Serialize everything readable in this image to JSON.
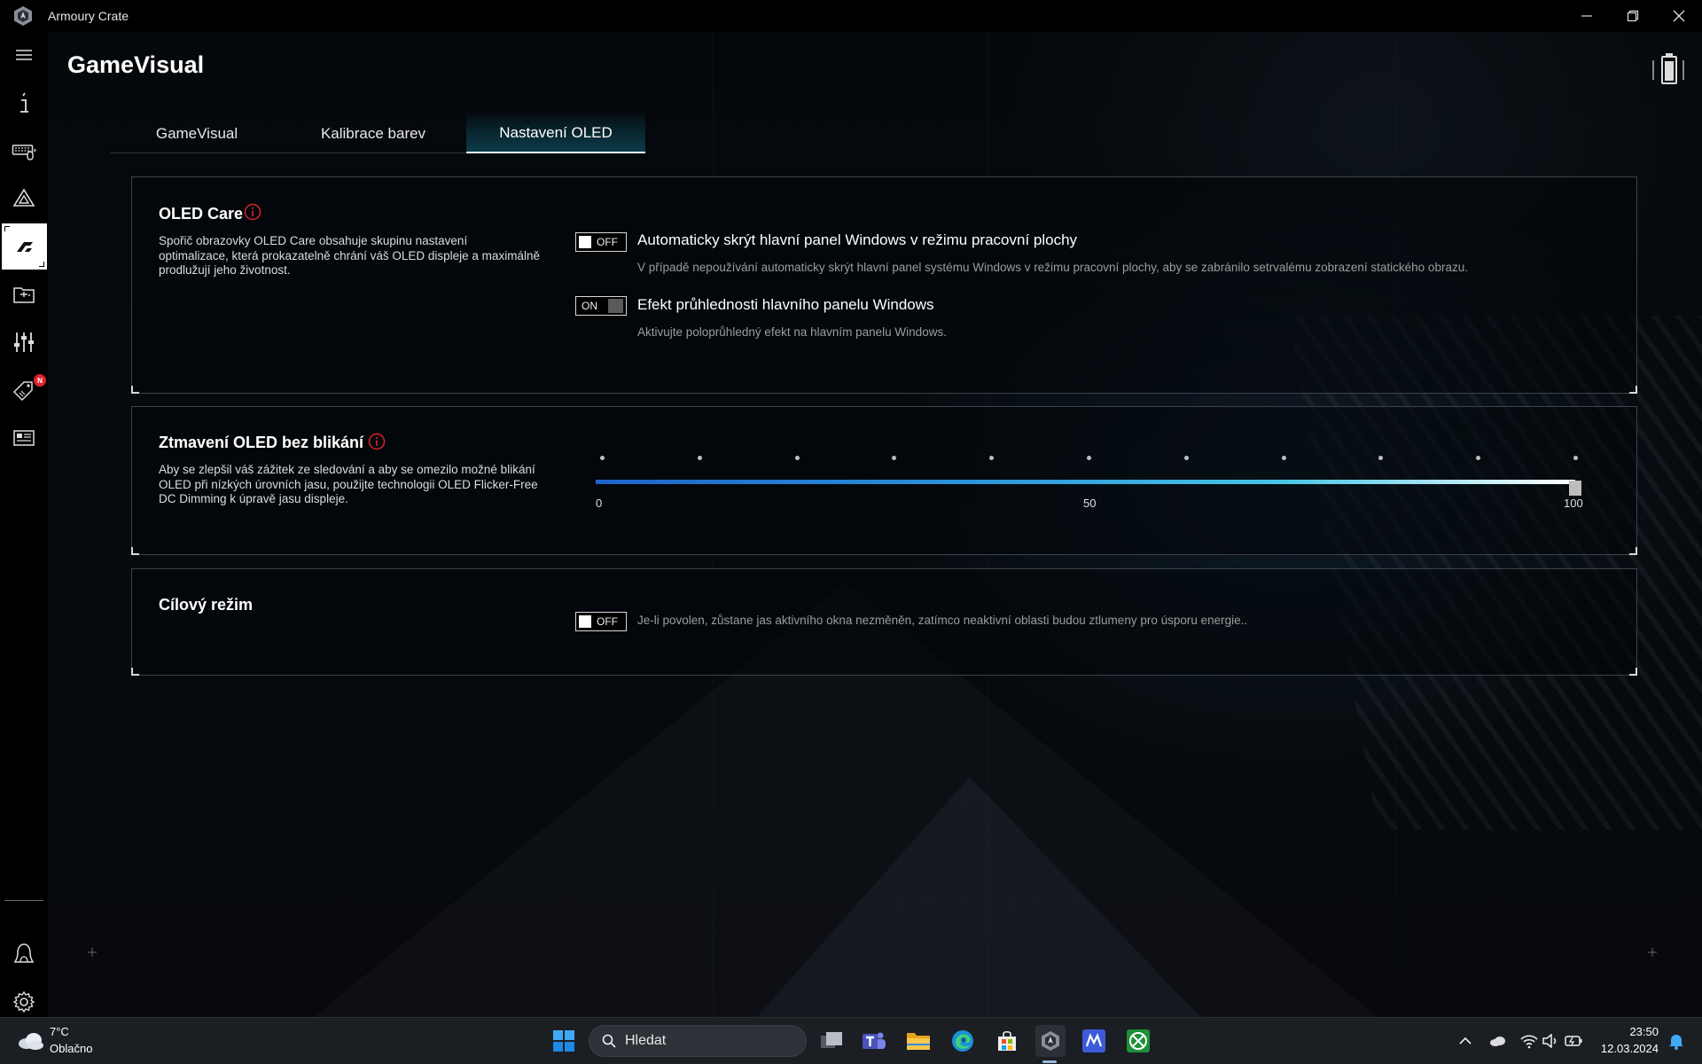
{
  "window": {
    "title": "Armoury Crate",
    "controls": [
      "minimize",
      "restore",
      "close"
    ]
  },
  "page": {
    "title": "GameVisual"
  },
  "tabs": [
    {
      "label": "GameVisual",
      "active": false
    },
    {
      "label": "Kalibrace barev",
      "active": false
    },
    {
      "label": "Nastavení OLED",
      "active": true
    }
  ],
  "sidebar": {
    "items": [
      {
        "icon": "menu-icon"
      },
      {
        "icon": "info-icon"
      },
      {
        "icon": "keyboard-mouse-icon"
      },
      {
        "icon": "aura-icon"
      },
      {
        "icon": "gamevisual-icon",
        "active": true
      },
      {
        "icon": "game-library-icon"
      },
      {
        "icon": "sliders-icon"
      },
      {
        "icon": "deals-tag-icon",
        "badge": "N"
      },
      {
        "icon": "news-icon"
      },
      {
        "icon": "user-icon"
      },
      {
        "icon": "settings-icon"
      }
    ]
  },
  "oled_care": {
    "title": "OLED Care",
    "description": "Spořič obrazovky OLED Care obsahuje skupinu nastavení optimalizace, která prokazatelně chrání váš OLED displeje a maximálně prodlužují jeho životnost.",
    "options": [
      {
        "state": "OFF",
        "label": "Automaticky skrýt hlavní panel Windows v režimu pracovní plochy",
        "description": "V případě nepoužívání automaticky skrýt hlavní panel systému Windows v režimu pracovní plochy, aby se zabránilo setrvalému zobrazení statického obrazu."
      },
      {
        "state": "ON",
        "label": "Efekt průhlednosti hlavního panelu Windows",
        "description": "Aktivujte poloprůhledný efekt na hlavním panelu Windows."
      }
    ]
  },
  "flicker_free": {
    "title": "Ztmavení OLED bez blikání",
    "description": "Aby se zlepšil váš zážitek ze sledování a aby se omezilo možné blikání OLED při nízkých úrovních jasu, použijte technologii OLED Flicker-Free DC Dimming k úpravě jasu displeje.",
    "slider": {
      "min_label": "0",
      "mid_label": "50",
      "max_label": "100",
      "value": 100,
      "tick_count": 11,
      "gradient_colors": [
        "#1e63c8",
        "#47c6e6",
        "#ffffff"
      ]
    }
  },
  "target_mode": {
    "title": "Cílový režim",
    "state": "OFF",
    "description": "Je-li povolen, zůstane jas aktivního okna nezměněn, zatímco neaktivní oblasti budou ztlumeny pro úsporu energie.."
  },
  "taskbar": {
    "weather": {
      "temp": "7°C",
      "desc": "Oblačno"
    },
    "search_placeholder": "Hledat",
    "apps": [
      "start-icon",
      "task-view-icon",
      "teams-icon",
      "file-explorer-icon",
      "edge-icon",
      "store-icon",
      "armoury-crate-icon",
      "myasus-icon",
      "xbox-icon"
    ],
    "clock": {
      "time": "23:50",
      "date": "12.03.2024"
    }
  },
  "colors": {
    "accent_tab": "#0c4250",
    "info_red": "#d8222c",
    "badge_red": "#e0222e",
    "panel_border": "#3c4349"
  }
}
